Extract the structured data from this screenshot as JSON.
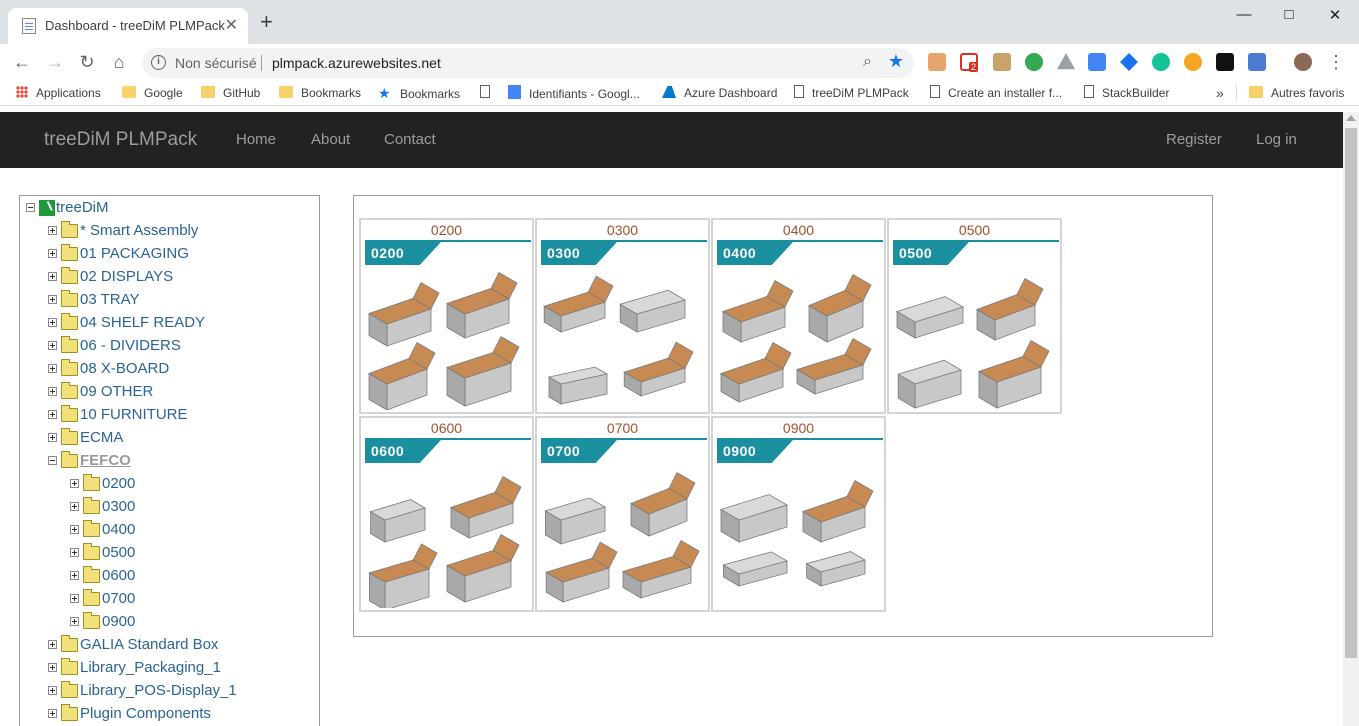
{
  "browser": {
    "tab_title": "Dashboard - treeDiM PLMPack",
    "tab_close": "✕",
    "new_tab": "+",
    "omnibox": {
      "security": "Non sécurisé",
      "url": "plmpack.azurewebsites.net"
    },
    "bookmarks": [
      {
        "label": "Applications",
        "icon": "apps-grid-icon"
      },
      {
        "label": "Google",
        "icon": "folder-icon"
      },
      {
        "label": "GitHub",
        "icon": "folder-icon"
      },
      {
        "label": "Bookmarks",
        "icon": "folder-icon"
      },
      {
        "label": "Bookmarks",
        "icon": "star-icon"
      },
      {
        "label": "",
        "icon": "page-icon"
      },
      {
        "label": "Identifiants - Googl...",
        "icon": "docs-icon"
      },
      {
        "label": "Azure Dashboard",
        "icon": "azure-icon"
      },
      {
        "label": "treeDiM PLMPack",
        "icon": "page-icon"
      },
      {
        "label": "Create an installer f...",
        "icon": "page-icon"
      },
      {
        "label": "StackBuilder",
        "icon": "page-icon"
      }
    ],
    "bookmarks_overflow": "»",
    "other_bookmarks": "Autres favoris",
    "extension_badge": "2"
  },
  "navbar": {
    "brand": "treeDiM PLMPack",
    "links": [
      "Home",
      "About",
      "Contact"
    ],
    "register": "Register",
    "login": "Log in"
  },
  "tree": {
    "root": "treeDiM",
    "items": [
      {
        "label": "* Smart Assembly",
        "expanded": false
      },
      {
        "label": "01 PACKAGING",
        "expanded": false
      },
      {
        "label": "02 DISPLAYS",
        "expanded": false
      },
      {
        "label": "03 TRAY",
        "expanded": false
      },
      {
        "label": "04 SHELF READY",
        "expanded": false
      },
      {
        "label": "06 - DIVIDERS",
        "expanded": false
      },
      {
        "label": "08 X-BOARD",
        "expanded": false
      },
      {
        "label": "09 OTHER",
        "expanded": false
      },
      {
        "label": "10 FURNITURE",
        "expanded": false
      },
      {
        "label": "ECMA",
        "expanded": false
      },
      {
        "label": "FEFCO",
        "expanded": true,
        "selected": true
      },
      {
        "label": "0200",
        "child": true
      },
      {
        "label": "0300",
        "child": true
      },
      {
        "label": "0400",
        "child": true
      },
      {
        "label": "0500",
        "child": true
      },
      {
        "label": "0600",
        "child": true
      },
      {
        "label": "0700",
        "child": true
      },
      {
        "label": "0900",
        "child": true
      },
      {
        "label": "GALIA Standard Box",
        "expanded": false
      },
      {
        "label": "Library_Packaging_1",
        "expanded": false
      },
      {
        "label": "Library_POS-Display_1",
        "expanded": false
      },
      {
        "label": "Plugin Components",
        "expanded": false
      }
    ]
  },
  "gallery": {
    "thumbnails": [
      {
        "title": "0200",
        "code": "0200"
      },
      {
        "title": "0300",
        "code": "0300"
      },
      {
        "title": "0400",
        "code": "0400"
      },
      {
        "title": "0500",
        "code": "0500"
      },
      {
        "title": "0600",
        "code": "0600"
      },
      {
        "title": "0700",
        "code": "0700"
      },
      {
        "title": "0900",
        "code": "0900"
      }
    ]
  },
  "colors": {
    "navbar_bg": "#222222",
    "link": "#2a6496",
    "thumb_title": "#a0522d",
    "banner": "#1a8fa0",
    "cardboard": "#c68a52",
    "box_grey": "#c8c8c8"
  }
}
